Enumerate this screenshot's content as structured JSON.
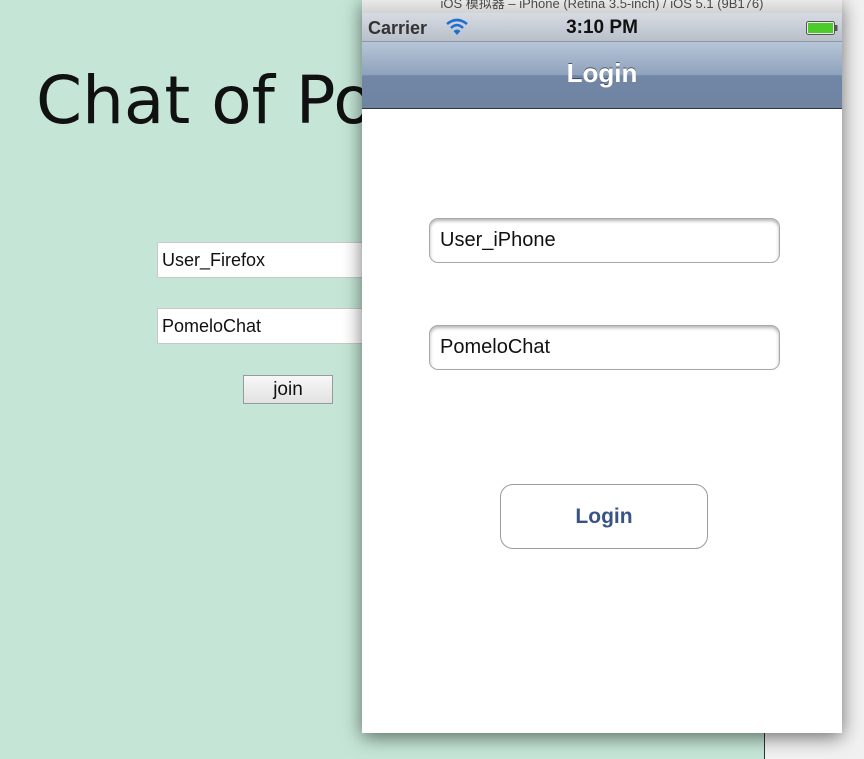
{
  "web_page": {
    "title": "Chat of Po",
    "username_value": "User_Firefox",
    "channel_value": "PomeloChat",
    "join_label": "join"
  },
  "simulator": {
    "window_title": "iOS 模拟器 – iPhone (Retina 3.5-inch) / iOS 5.1 (9B176)",
    "status_bar": {
      "carrier": "Carrier",
      "time": "3:10 PM",
      "wifi_icon": "wifi-icon",
      "battery_icon": "battery-icon"
    },
    "nav_title": "Login",
    "username_value": "User_iPhone",
    "channel_value": "PomeloChat",
    "login_label": "Login"
  },
  "colors": {
    "page_background": "#c5e6d6",
    "nav_bar": "#8fa2bc",
    "button_text": "#385487",
    "battery_fill": "#4ccb2b"
  }
}
